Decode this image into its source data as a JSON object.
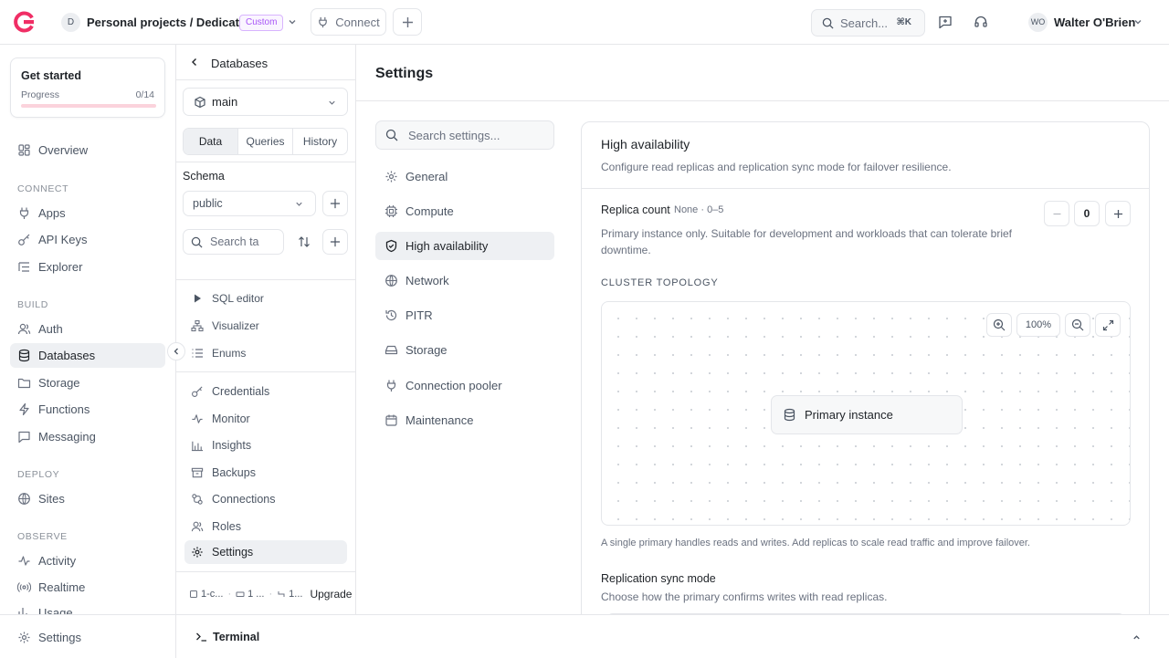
{
  "topbar": {
    "project_initial": "D",
    "project_title": "Personal projects / Dedicated",
    "badge": "Custom",
    "connect_label": "Connect",
    "search_placeholder": "Search...",
    "search_shortcut": "⌘K",
    "user_initials": "WO",
    "user_name": "Walter O'Brien"
  },
  "sidebar": {
    "get_started": {
      "title": "Get started",
      "progress_label": "Progress",
      "progress_count": "0/14",
      "progress_fraction": 0.0
    },
    "overview": "Overview",
    "sections": {
      "connect": "CONNECT",
      "build": "BUILD",
      "deploy": "DEPLOY",
      "observe": "OBSERVE"
    },
    "connect_items": [
      "Apps",
      "API Keys",
      "Explorer"
    ],
    "build_items": [
      "Auth",
      "Databases",
      "Storage",
      "Functions",
      "Messaging"
    ],
    "deploy_items": [
      "Sites"
    ],
    "observe_items": [
      "Activity",
      "Realtime",
      "Usage"
    ],
    "bottom_settings": "Settings"
  },
  "db_panel": {
    "back_title": "Databases",
    "database": "main",
    "tabs": [
      "Data",
      "Queries",
      "History"
    ],
    "schema_label": "Schema",
    "schema_value": "public",
    "table_search_placeholder": "Search ta",
    "tools": [
      "SQL editor",
      "Visualizer",
      "Enums"
    ],
    "items": [
      "Credentials",
      "Monitor",
      "Insights",
      "Backups",
      "Connections",
      "Roles",
      "Settings"
    ],
    "footer": {
      "cpu": "1-c...",
      "mem": "1 ...",
      "conn": "1...",
      "upgrade": "Upgrade"
    }
  },
  "settings": {
    "title": "Settings",
    "search_placeholder": "Search settings...",
    "nav": [
      "General",
      "Compute",
      "High availability",
      "Network",
      "PITR",
      "Storage",
      "Connection pooler",
      "Maintenance"
    ]
  },
  "ha_card": {
    "title": "High availability",
    "description": "Configure read replicas and replication sync mode for failover resilience.",
    "replica_label": "Replica count",
    "replica_meta": "None · 0–5",
    "replica_value": "0",
    "replica_desc": "Primary instance only. Suitable for development and workloads that can tolerate brief downtime.",
    "topology_label": "CLUSTER TOPOLOGY",
    "zoom": "100%",
    "node_label": "Primary instance",
    "topology_note": "A single primary handles reads and writes. Add replicas to scale read traffic and improve failover.",
    "sync_title": "Replication sync mode",
    "sync_desc": "Choose how the primary confirms writes with read replicas."
  },
  "terminal": {
    "label": "Terminal"
  },
  "colors": {
    "brand": "#f02e65",
    "active_bg": "#eef0f3",
    "border": "#e4e6ea"
  }
}
